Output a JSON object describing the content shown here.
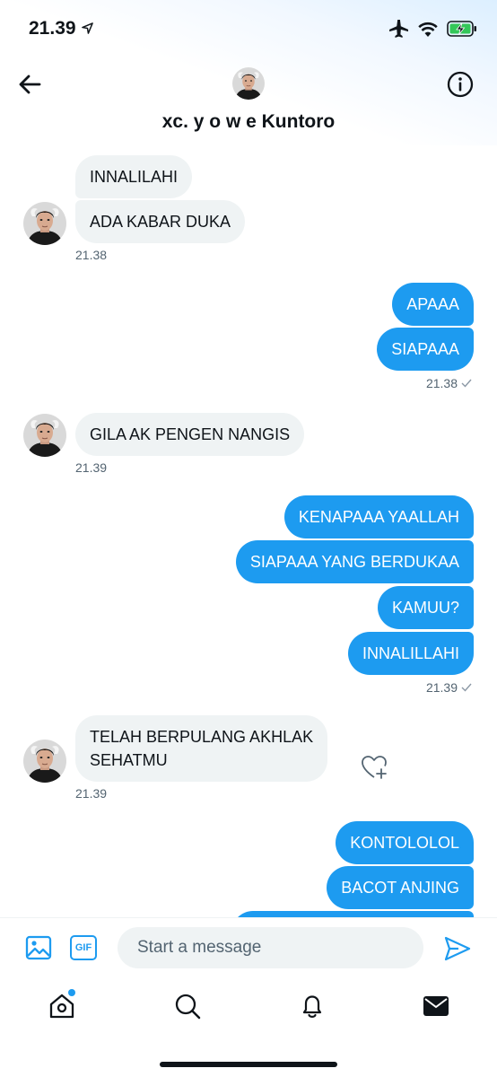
{
  "status": {
    "time": "21.39",
    "icons": [
      "location-arrow-icon",
      "airplane-icon",
      "wifi-icon",
      "battery-charging-icon"
    ]
  },
  "header": {
    "title": "xc. y o w e Kuntoro",
    "back_icon": "arrow-left-icon",
    "info_icon": "info-icon"
  },
  "messages": [
    {
      "side": "in",
      "text": "INNALILAHI"
    },
    {
      "side": "in",
      "text": "ADA KABAR DUKA"
    },
    {
      "side": "in_time",
      "text": "21.38"
    },
    {
      "side": "out",
      "text": "APAAA"
    },
    {
      "side": "out",
      "text": "SIAPAAA"
    },
    {
      "side": "out_time",
      "text": "21.38"
    },
    {
      "side": "in",
      "text": "GILA AK PENGEN NANGIS"
    },
    {
      "side": "in_time",
      "text": "21.39"
    },
    {
      "side": "out",
      "text": "KENAPAAA YAALLAH"
    },
    {
      "side": "out",
      "text": "SIAPAAA YANG BERDUKAA"
    },
    {
      "side": "out",
      "text": "KAMUU?"
    },
    {
      "side": "out",
      "text": "INNALILLAHI"
    },
    {
      "side": "out_time",
      "text": "21.39"
    },
    {
      "side": "in",
      "text": "TELAH BERPULANG AKHLAK",
      "text2": "SEHATMU"
    },
    {
      "side": "in_time",
      "text": "21.39"
    },
    {
      "side": "out",
      "text": "KONTOLOLOL"
    },
    {
      "side": "out",
      "text": "BACOT ANJING"
    }
  ],
  "composer": {
    "placeholder": "Start a message",
    "gif_label": "GIF"
  },
  "nav": {
    "items": [
      "home-icon",
      "search-icon",
      "notifications-icon",
      "messages-icon"
    ],
    "active": "messages-icon",
    "home_has_dot": true
  },
  "colors": {
    "accent": "#1d9bf0",
    "incoming_bubble": "#eff3f4",
    "text": "#0f1419",
    "muted": "#536471"
  }
}
